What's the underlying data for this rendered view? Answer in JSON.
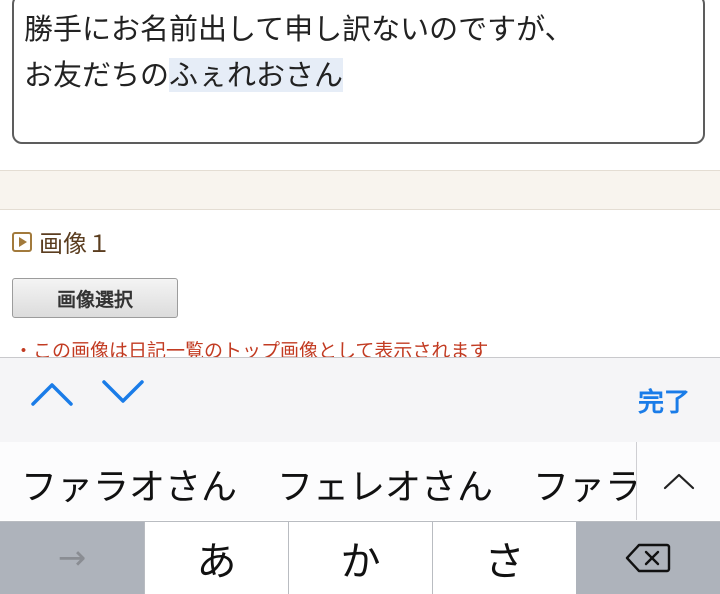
{
  "textarea": {
    "line1": "勝手にお名前出して申し訳ないのですが、",
    "line2_prefix": "お友だちの",
    "line2_marked": "ふぇれおさん"
  },
  "image_section": {
    "heading": "画像１",
    "select_button": "画像選択",
    "note": "・この画像は日記一覧のトップ画像として表示されます"
  },
  "accessory_bar": {
    "done_label": "完了",
    "accent_color": "#1a7ce8"
  },
  "candidates": [
    "ファラオさん",
    "フェレオさん",
    "ファラ"
  ],
  "keyboard": {
    "keys": [
      "あ",
      "か",
      "さ"
    ],
    "arrow_key": "→"
  }
}
